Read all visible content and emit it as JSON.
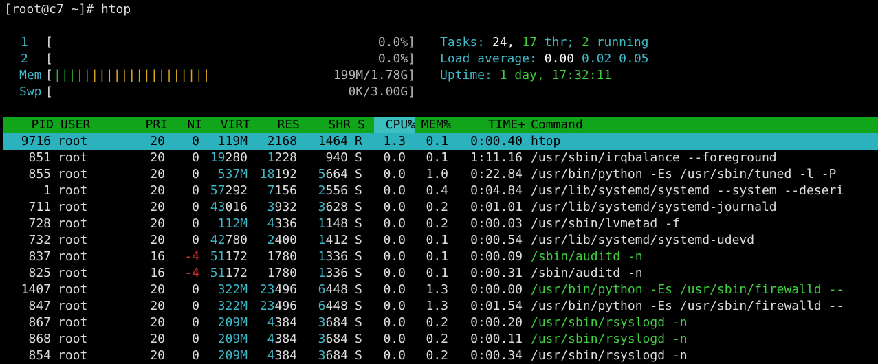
{
  "terminal": {
    "prompt": "[root@c7 ~]# htop"
  },
  "meters": {
    "cpu": [
      {
        "label": "1",
        "value": "0.0%]"
      },
      {
        "label": "2",
        "value": "0.0%]"
      }
    ],
    "mem": {
      "label": "Mem",
      "value": "199M/1.78G]",
      "bars_used": "||||",
      "bars_buf": "|",
      "bars_cache": "||||||||||||||||"
    },
    "swp": {
      "label": "Swp",
      "value": "0K/3.00G]"
    }
  },
  "summary": {
    "tasks_label": "Tasks:",
    "tasks": "24,",
    "threads": "17",
    "thr_label": "thr;",
    "running": "2",
    "running_label": "running",
    "load_label": "Load average:",
    "load1": "0.00",
    "load5": "0.02",
    "load15": "0.05",
    "uptime_label": "Uptime:",
    "uptime": "1 day, 17:32:11"
  },
  "columns": [
    "PID",
    "USER",
    "PRI",
    "NI",
    "VIRT",
    "RES",
    "SHR",
    "S",
    "CPU%",
    "MEM%",
    "TIME+",
    "Command"
  ],
  "processes": [
    {
      "pid": "9716",
      "user": "root",
      "pri": "20",
      "ni": "0",
      "virt": "119M",
      "res": "2168",
      "shr": "1464",
      "s": "R",
      "cpu": "1.3",
      "mem": "0.1",
      "time": "0:00.40",
      "cmd": "htop",
      "selected": true
    },
    {
      "pid": "851",
      "user": "root",
      "pri": "20",
      "ni": "0",
      "virt_hi": "19",
      "virt_lo": "280",
      "res_hi": "1",
      "res_lo": "228",
      "shr": "940",
      "s": "S",
      "cpu": "0.0",
      "mem": "0.1",
      "time": "1:11.16",
      "cmd": "/usr/sbin/irqbalance --foreground"
    },
    {
      "pid": "855",
      "user": "root",
      "pri": "20",
      "ni": "0",
      "virt_hi": "537M",
      "virt_lo": "",
      "res_hi": "18",
      "res_lo": "192",
      "shr_hi": "5",
      "shr_lo": "664",
      "s": "S",
      "cpu": "0.0",
      "mem": "1.0",
      "time": "0:22.84",
      "cmd": "/usr/bin/python -Es /usr/sbin/tuned -l -P"
    },
    {
      "pid": "1",
      "user": "root",
      "pri": "20",
      "ni": "0",
      "virt_hi": "57",
      "virt_lo": "292",
      "res_hi": "7",
      "res_lo": "156",
      "shr_hi": "2",
      "shr_lo": "556",
      "s": "S",
      "cpu": "0.0",
      "mem": "0.4",
      "time": "0:04.84",
      "cmd": "/usr/lib/systemd/systemd --system --deseri"
    },
    {
      "pid": "711",
      "user": "root",
      "pri": "20",
      "ni": "0",
      "virt_hi": "43",
      "virt_lo": "016",
      "res_hi": "3",
      "res_lo": "932",
      "shr_hi": "3",
      "shr_lo": "628",
      "s": "S",
      "cpu": "0.0",
      "mem": "0.2",
      "time": "0:01.01",
      "cmd": "/usr/lib/systemd/systemd-journald"
    },
    {
      "pid": "728",
      "user": "root",
      "pri": "20",
      "ni": "0",
      "virt_hi": "112M",
      "virt_lo": "",
      "res_hi": "4",
      "res_lo": "336",
      "shr_hi": "1",
      "shr_lo": "148",
      "s": "S",
      "cpu": "0.0",
      "mem": "0.2",
      "time": "0:00.03",
      "cmd": "/usr/sbin/lvmetad -f"
    },
    {
      "pid": "732",
      "user": "root",
      "pri": "20",
      "ni": "0",
      "virt_hi": "42",
      "virt_lo": "780",
      "res_hi": "2",
      "res_lo": "400",
      "shr_hi": "1",
      "shr_lo": "412",
      "s": "S",
      "cpu": "0.0",
      "mem": "0.1",
      "time": "0:00.54",
      "cmd": "/usr/lib/systemd/systemd-udevd"
    },
    {
      "pid": "837",
      "user": "root",
      "pri": "16",
      "ni": "-4",
      "virt_hi": "51",
      "virt_lo": "172",
      "res_hi": "",
      "res_lo": "1780",
      "shr_hi": "1",
      "shr_lo": "336",
      "s": "S",
      "cpu": "0.0",
      "mem": "0.1",
      "time": "0:00.09",
      "cmd": "/sbin/auditd -n",
      "thread": true
    },
    {
      "pid": "825",
      "user": "root",
      "pri": "16",
      "ni": "-4",
      "virt_hi": "51",
      "virt_lo": "172",
      "res_hi": "",
      "res_lo": "1780",
      "shr_hi": "1",
      "shr_lo": "336",
      "s": "S",
      "cpu": "0.0",
      "mem": "0.1",
      "time": "0:00.31",
      "cmd": "/sbin/auditd -n"
    },
    {
      "pid": "1407",
      "user": "root",
      "pri": "20",
      "ni": "0",
      "virt_hi": "322M",
      "virt_lo": "",
      "res_hi": "23",
      "res_lo": "496",
      "shr_hi": "6",
      "shr_lo": "448",
      "s": "S",
      "cpu": "0.0",
      "mem": "1.3",
      "time": "0:00.00",
      "cmd": "/usr/bin/python -Es /usr/sbin/firewalld --",
      "thread": true
    },
    {
      "pid": "847",
      "user": "root",
      "pri": "20",
      "ni": "0",
      "virt_hi": "322M",
      "virt_lo": "",
      "res_hi": "23",
      "res_lo": "496",
      "shr_hi": "6",
      "shr_lo": "448",
      "s": "S",
      "cpu": "0.0",
      "mem": "1.3",
      "time": "0:01.54",
      "cmd": "/usr/bin/python -Es /usr/sbin/firewalld --"
    },
    {
      "pid": "867",
      "user": "root",
      "pri": "20",
      "ni": "0",
      "virt_hi": "209M",
      "virt_lo": "",
      "res_hi": "4",
      "res_lo": "384",
      "shr_hi": "3",
      "shr_lo": "684",
      "s": "S",
      "cpu": "0.0",
      "mem": "0.2",
      "time": "0:00.20",
      "cmd": "/usr/sbin/rsyslogd -n",
      "thread": true
    },
    {
      "pid": "868",
      "user": "root",
      "pri": "20",
      "ni": "0",
      "virt_hi": "209M",
      "virt_lo": "",
      "res_hi": "4",
      "res_lo": "384",
      "shr_hi": "3",
      "shr_lo": "684",
      "s": "S",
      "cpu": "0.0",
      "mem": "0.2",
      "time": "0:00.11",
      "cmd": "/usr/sbin/rsyslogd -n",
      "thread": true
    },
    {
      "pid": "854",
      "user": "root",
      "pri": "20",
      "ni": "0",
      "virt_hi": "209M",
      "virt_lo": "",
      "res_hi": "4",
      "res_lo": "384",
      "shr_hi": "3",
      "shr_lo": "684",
      "s": "S",
      "cpu": "0.0",
      "mem": "0.2",
      "time": "0:00.34",
      "cmd": "/usr/sbin/rsyslogd -n"
    }
  ]
}
